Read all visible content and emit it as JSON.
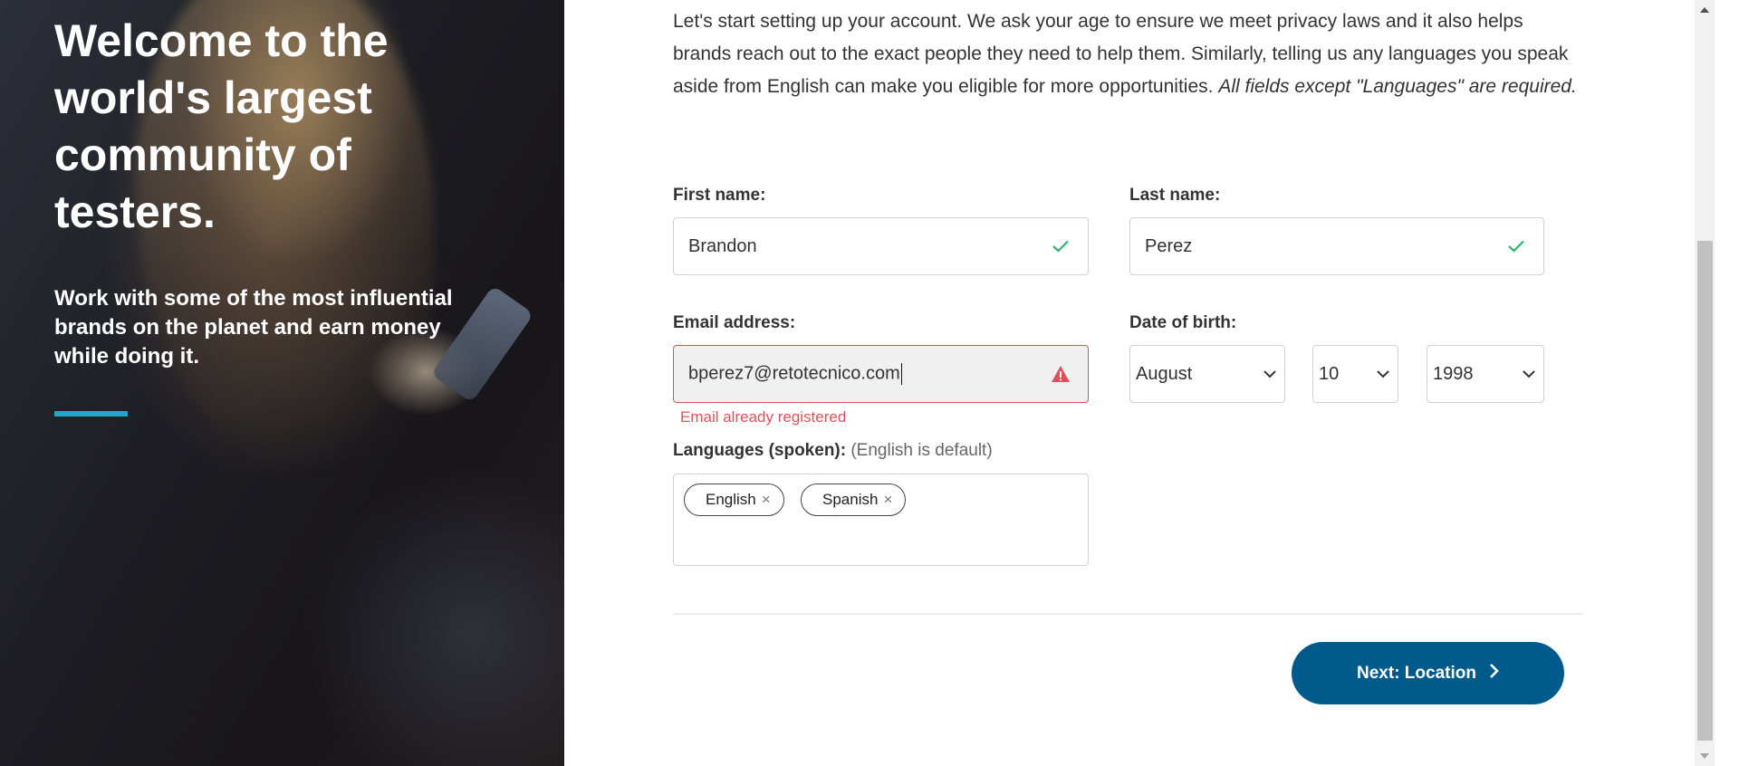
{
  "hero": {
    "title": "Welcome to the world's largest community of testers.",
    "subtitle": "Work with some of the most influential brands on the planet and earn money while doing it.",
    "accent_color": "#23a6c8"
  },
  "intro": {
    "text": "Let's start setting up your account. We ask your age to ensure we meet privacy laws and it also helps brands reach out to the exact people they need to help them. Similarly, telling us any languages you speak aside from English can make you eligible for more opportunities.",
    "required_note": "All fields except \"Languages\" are required."
  },
  "form": {
    "first_name": {
      "label": "First name:",
      "value": "Brandon",
      "status_icon": "check-icon",
      "status_color": "#2bb56a"
    },
    "last_name": {
      "label": "Last name:",
      "value": "Perez",
      "status_icon": "check-icon",
      "status_color": "#2bb56a"
    },
    "email": {
      "label": "Email address:",
      "value": "bperez7@retotecnico.com",
      "status_icon": "warning-icon",
      "status_color": "#e0505a",
      "error": "Email already registered"
    },
    "dob": {
      "label": "Date of birth:",
      "month": "August",
      "day": "10",
      "year": "1998"
    },
    "languages": {
      "label": "Languages (spoken):",
      "hint": "(English is default)",
      "chips": [
        "English",
        "Spanish"
      ]
    }
  },
  "actions": {
    "next_label": "Next: Location",
    "next_color": "#005a8c"
  }
}
